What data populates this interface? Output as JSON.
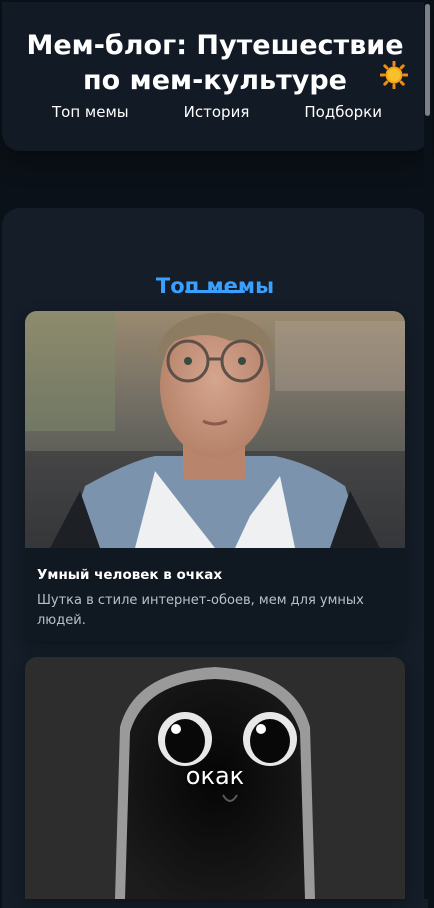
{
  "header": {
    "title": "Мем-блог: Путешествие по мем-культуре",
    "nav": [
      {
        "label": "Топ мемы"
      },
      {
        "label": "История"
      },
      {
        "label": "Подборки"
      }
    ]
  },
  "section": {
    "title": "Топ мемы"
  },
  "cards": [
    {
      "title": "Умный человек в очках",
      "description": "Шутка в стиле интернет-обоев, мем для умных людей."
    },
    {
      "caption": "окак"
    }
  ],
  "colors": {
    "accent": "#3aa0ff",
    "background": "#0b1118",
    "surface": "#141d28"
  }
}
